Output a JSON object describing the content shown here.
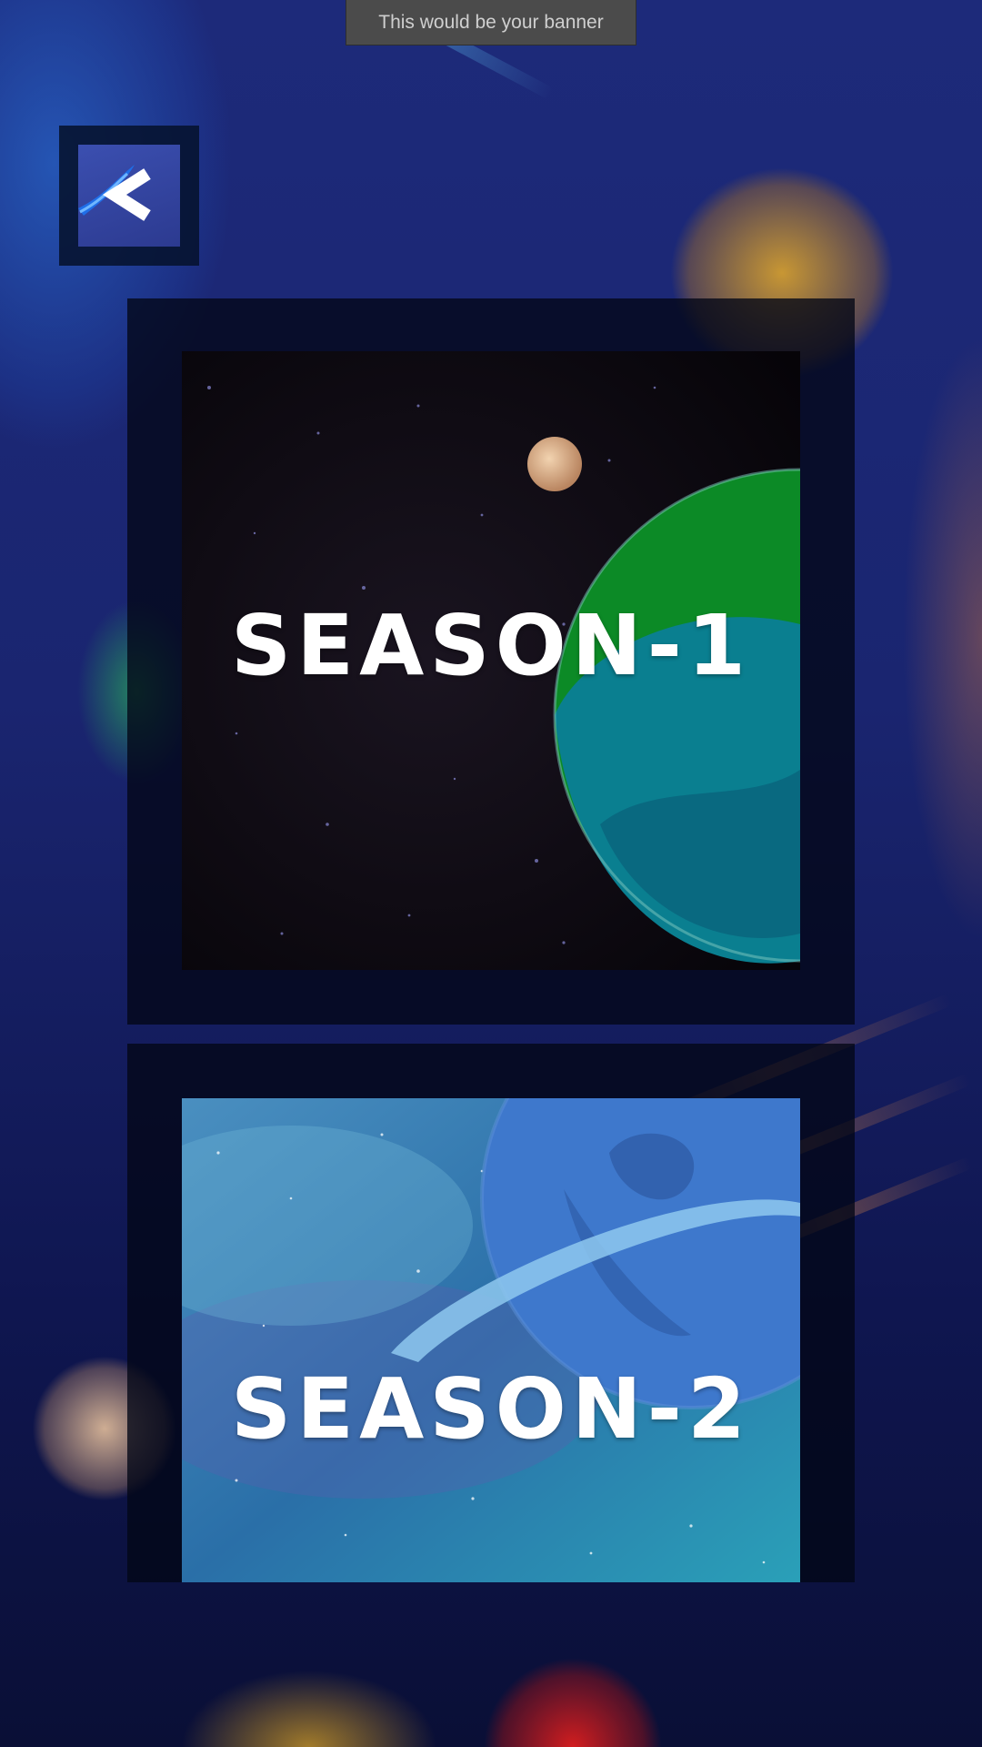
{
  "banner": {
    "text": "This would be your banner"
  },
  "back_button": {
    "icon": "back-arrow-icon",
    "glyph": "<"
  },
  "seasons": [
    {
      "label": "SEASON-1",
      "theme": "dark-space-green-planet"
    },
    {
      "label": "SEASON-2",
      "theme": "blue-nebula-ringed-planet"
    }
  ],
  "colors": {
    "background": "#1a2570",
    "card": "#03061c",
    "banner": "#4b4b4b",
    "banner_text": "#cfcfcf",
    "label": "#ffffff"
  }
}
